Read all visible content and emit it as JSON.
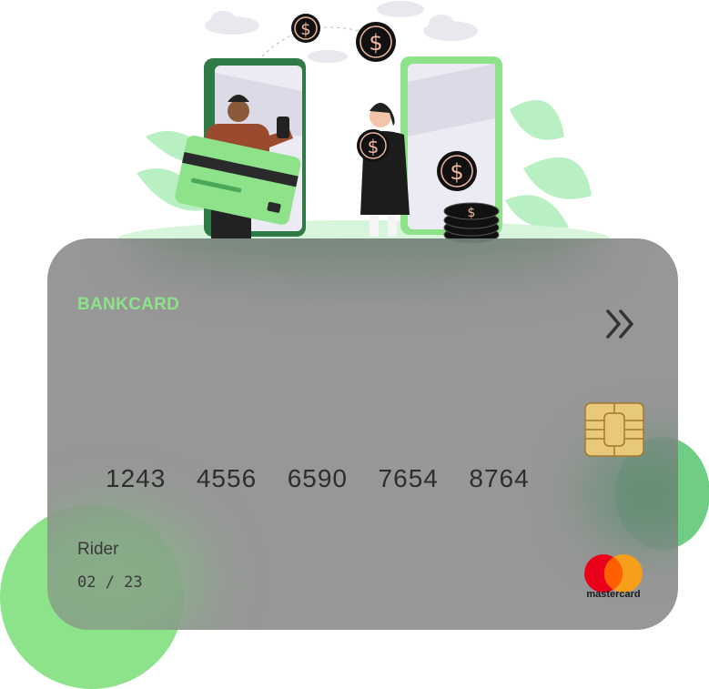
{
  "card": {
    "brand": "BANKCARD",
    "number": "1243  4556  6590  7654  8764",
    "holder": "Rider",
    "expiry": "02 / 23",
    "network": "mastercard"
  },
  "colors": {
    "brand_green": "#8ee38a",
    "card_gray": "#8c8c8c",
    "accent_green": "#6fce84"
  },
  "icons": [
    "dollar-coin-icon",
    "double-chevron-right-icon",
    "card-chip-icon",
    "mastercard-logo-icon"
  ]
}
